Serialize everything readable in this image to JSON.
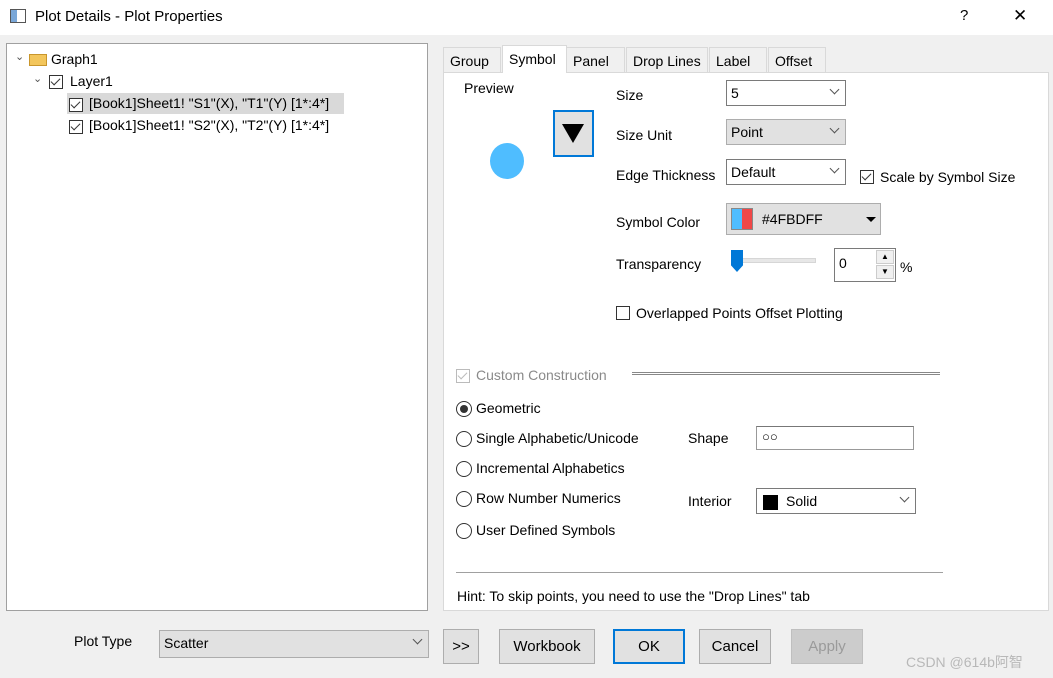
{
  "window": {
    "title": "Plot Details - Plot Properties",
    "help": "?",
    "close": "✕"
  },
  "tree": {
    "root": "Graph1",
    "layer": "Layer1",
    "items": [
      "[Book1]Sheet1! \"S1\"(X), \"T1\"(Y) [1*:4*]",
      "[Book1]Sheet1! \"S2\"(X), \"T2\"(Y) [1*:4*]"
    ]
  },
  "tabs": [
    "Group",
    "Symbol",
    "Panel",
    "Drop Lines",
    "Label",
    "Offset"
  ],
  "symbol": {
    "preview_label": "Preview",
    "preview_color": "#4FBDFF",
    "size_label": "Size",
    "size_value": "5",
    "size_unit_label": "Size Unit",
    "size_unit_value": "Point",
    "edge_label": "Edge Thickness",
    "edge_value": "Default",
    "scale_label": "Scale by Symbol Size",
    "scale_checked": true,
    "color_label": "Symbol Color",
    "color_value": "#4FBDFF",
    "transparency_label": "Transparency",
    "transparency_value": "0",
    "transparency_unit": "%",
    "overlap_label": "Overlapped Points Offset Plotting",
    "overlap_checked": false,
    "custom_label": "Custom Construction",
    "radios": [
      "Geometric",
      "Single Alphabetic/Unicode",
      "Incremental Alphabetics",
      "Row Number Numerics",
      "User Defined Symbols"
    ],
    "selected_radio": "Geometric",
    "shape_label": "Shape",
    "shape_value": "○○",
    "interior_label": "Interior",
    "interior_value": "Solid",
    "hint": "Hint: To skip points, you need to use the \"Drop Lines\" tab"
  },
  "footer": {
    "plot_type_label": "Plot Type",
    "plot_type_value": "Scatter",
    "expand": ">>",
    "workbook": "Workbook",
    "ok": "OK",
    "cancel": "Cancel",
    "apply": "Apply",
    "watermark": "CSDN @614b阿智"
  }
}
